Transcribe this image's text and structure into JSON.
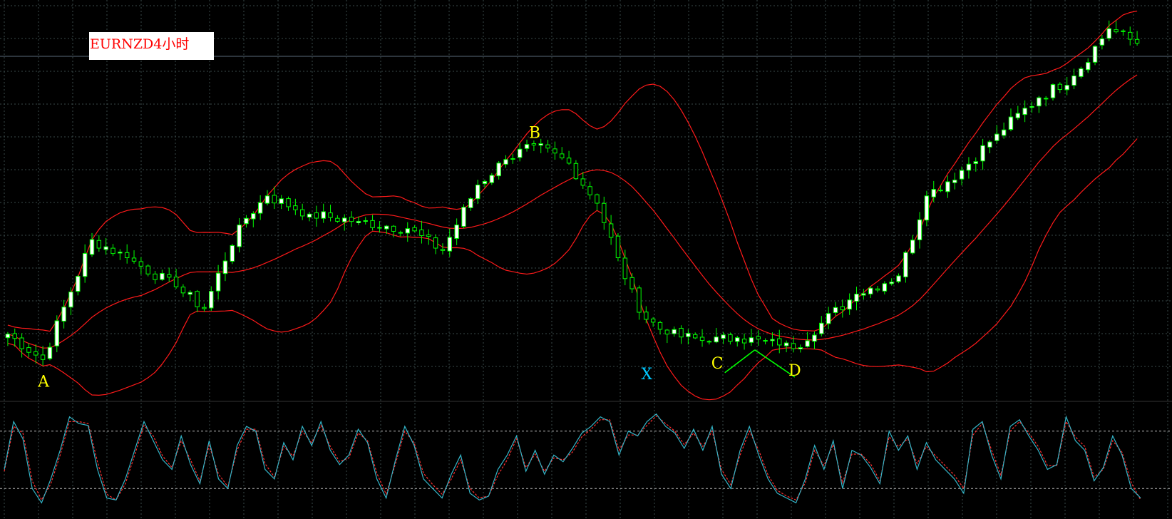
{
  "title": "EURNZD4小时",
  "colors": {
    "background": "#000000",
    "grid": "#3a4a4a",
    "bull_candle": "#ffffff",
    "bear_candle": "#000000",
    "candle_outline": "#00ff00",
    "bollinger": "#ff1a1a",
    "stoch_main": "#33b5c8",
    "stoch_signal": "#ff3030",
    "label_main": "#ffff00",
    "label_x": "#00c8ff",
    "cd_lines": "#00ff00"
  },
  "chart_data": [
    {
      "type": "candlestick",
      "symbol": "EURNZD",
      "timeframe": "H4",
      "indicators": [
        "bollinger_bands"
      ],
      "grid": true,
      "y_scale": [
        0,
        100
      ],
      "pattern_points": [
        {
          "label": "A",
          "x_index": 5,
          "price": 7,
          "label_color": "#ffff00"
        },
        {
          "label": "B",
          "x_index": 75,
          "price": 66,
          "label_color": "#ffff00"
        },
        {
          "label": "X",
          "x_index": 91,
          "price": 9,
          "label_color": "#00c8ff"
        },
        {
          "label": "C",
          "x_index": 101,
          "price": 12,
          "label_color": "#ffff00"
        },
        {
          "label": "D",
          "x_index": 112,
          "price": 10,
          "label_color": "#ffff00"
        }
      ],
      "anchors": [
        [
          0,
          14
        ],
        [
          5,
          7
        ],
        [
          12,
          40
        ],
        [
          17,
          35
        ],
        [
          24,
          27
        ],
        [
          28,
          21
        ],
        [
          33,
          44
        ],
        [
          37,
          52
        ],
        [
          43,
          47
        ],
        [
          50,
          45
        ],
        [
          57,
          43
        ],
        [
          62,
          37
        ],
        [
          67,
          55
        ],
        [
          71,
          62
        ],
        [
          75,
          66
        ],
        [
          80,
          61
        ],
        [
          84,
          50
        ],
        [
          87,
          35
        ],
        [
          90,
          20
        ],
        [
          94,
          14
        ],
        [
          100,
          12
        ],
        [
          104,
          13
        ],
        [
          110,
          11
        ],
        [
          112,
          10
        ],
        [
          116,
          17
        ],
        [
          121,
          25
        ],
        [
          127,
          30
        ],
        [
          131,
          52
        ],
        [
          136,
          59
        ],
        [
          141,
          69
        ],
        [
          147,
          79
        ],
        [
          152,
          85
        ],
        [
          157,
          98
        ],
        [
          161,
          94
        ]
      ]
    },
    {
      "type": "line",
      "indicator": "stochastic",
      "series": [
        {
          "values": [
            40,
            90,
            72,
            20,
            5,
            30,
            60,
            95,
            88,
            86,
            40,
            10,
            8,
            30,
            60,
            90,
            70,
            50,
            40,
            75,
            45,
            25,
            70,
            30,
            20,
            65,
            85,
            80,
            40,
            30,
            68,
            50,
            85,
            65,
            90,
            60,
            45,
            55,
            82,
            68,
            30,
            10,
            50,
            85,
            65,
            30,
            20,
            10,
            35,
            55,
            15,
            8,
            12,
            40,
            55,
            75,
            38,
            60,
            35,
            55,
            48,
            62,
            78,
            85,
            95,
            90,
            55,
            80,
            75,
            90,
            98,
            85,
            78,
            62,
            82,
            60,
            85,
            35,
            20,
            60,
            85,
            55,
            30,
            15,
            10,
            5,
            30,
            65,
            40,
            70,
            20,
            60,
            55,
            42,
            25,
            80,
            60,
            75,
            40,
            68,
            50,
            40,
            30,
            15,
            82,
            90,
            55,
            30,
            85,
            92,
            75,
            60,
            40,
            45,
            95,
            70,
            60,
            28,
            42,
            75,
            55,
            20,
            10
          ]
        },
        {
          "values": [
            38,
            85,
            78,
            28,
            8,
            25,
            55,
            90,
            90,
            88,
            48,
            14,
            8,
            25,
            55,
            86,
            75,
            54,
            42,
            70,
            50,
            28,
            65,
            35,
            22,
            60,
            82,
            82,
            46,
            32,
            64,
            54,
            80,
            68,
            86,
            64,
            48,
            52,
            78,
            70,
            36,
            14,
            46,
            80,
            68,
            36,
            24,
            14,
            30,
            50,
            20,
            10,
            12,
            34,
            50,
            72,
            42,
            56,
            38,
            52,
            50,
            58,
            74,
            82,
            92,
            92,
            60,
            76,
            76,
            86,
            96,
            88,
            80,
            66,
            78,
            64,
            80,
            40,
            24,
            55,
            80,
            60,
            34,
            18,
            12,
            8,
            26,
            60,
            44,
            66,
            26,
            56,
            56,
            46,
            28,
            74,
            64,
            72,
            46,
            64,
            54,
            44,
            34,
            20,
            76,
            88,
            60,
            34,
            80,
            90,
            78,
            64,
            44,
            44,
            90,
            74,
            64,
            32,
            40,
            70,
            58,
            26,
            8
          ]
        }
      ]
    }
  ]
}
